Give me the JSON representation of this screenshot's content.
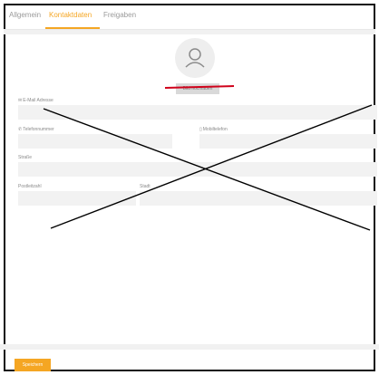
{
  "tabs": [
    {
      "label": "Allgemein",
      "active": false
    },
    {
      "label": "Kontaktdaten",
      "active": true
    },
    {
      "label": "Freigaben",
      "active": false
    }
  ],
  "avatar": {
    "icon": "user-icon"
  },
  "upload_button": {
    "label": "Bild hochladen"
  },
  "fields": {
    "email": {
      "label": "E-Mail Adresse",
      "icon": "envelope-icon",
      "value": ""
    },
    "phone": {
      "label": "Telefonnummer",
      "icon": "phone-icon",
      "value": ""
    },
    "mobile": {
      "label": "Mobiltelefon",
      "icon": "mobile-icon",
      "value": ""
    },
    "street": {
      "label": "Straße",
      "value": ""
    },
    "zip": {
      "label": "Postleitzahl",
      "value": ""
    },
    "city": {
      "label": "Stadt",
      "value": ""
    }
  },
  "save_button": {
    "label": "Speichern"
  },
  "colors": {
    "accent": "#f5a623",
    "field_bg": "#f2f2f2",
    "annotation_red": "#d0021b",
    "annotation_black": "#000000"
  }
}
